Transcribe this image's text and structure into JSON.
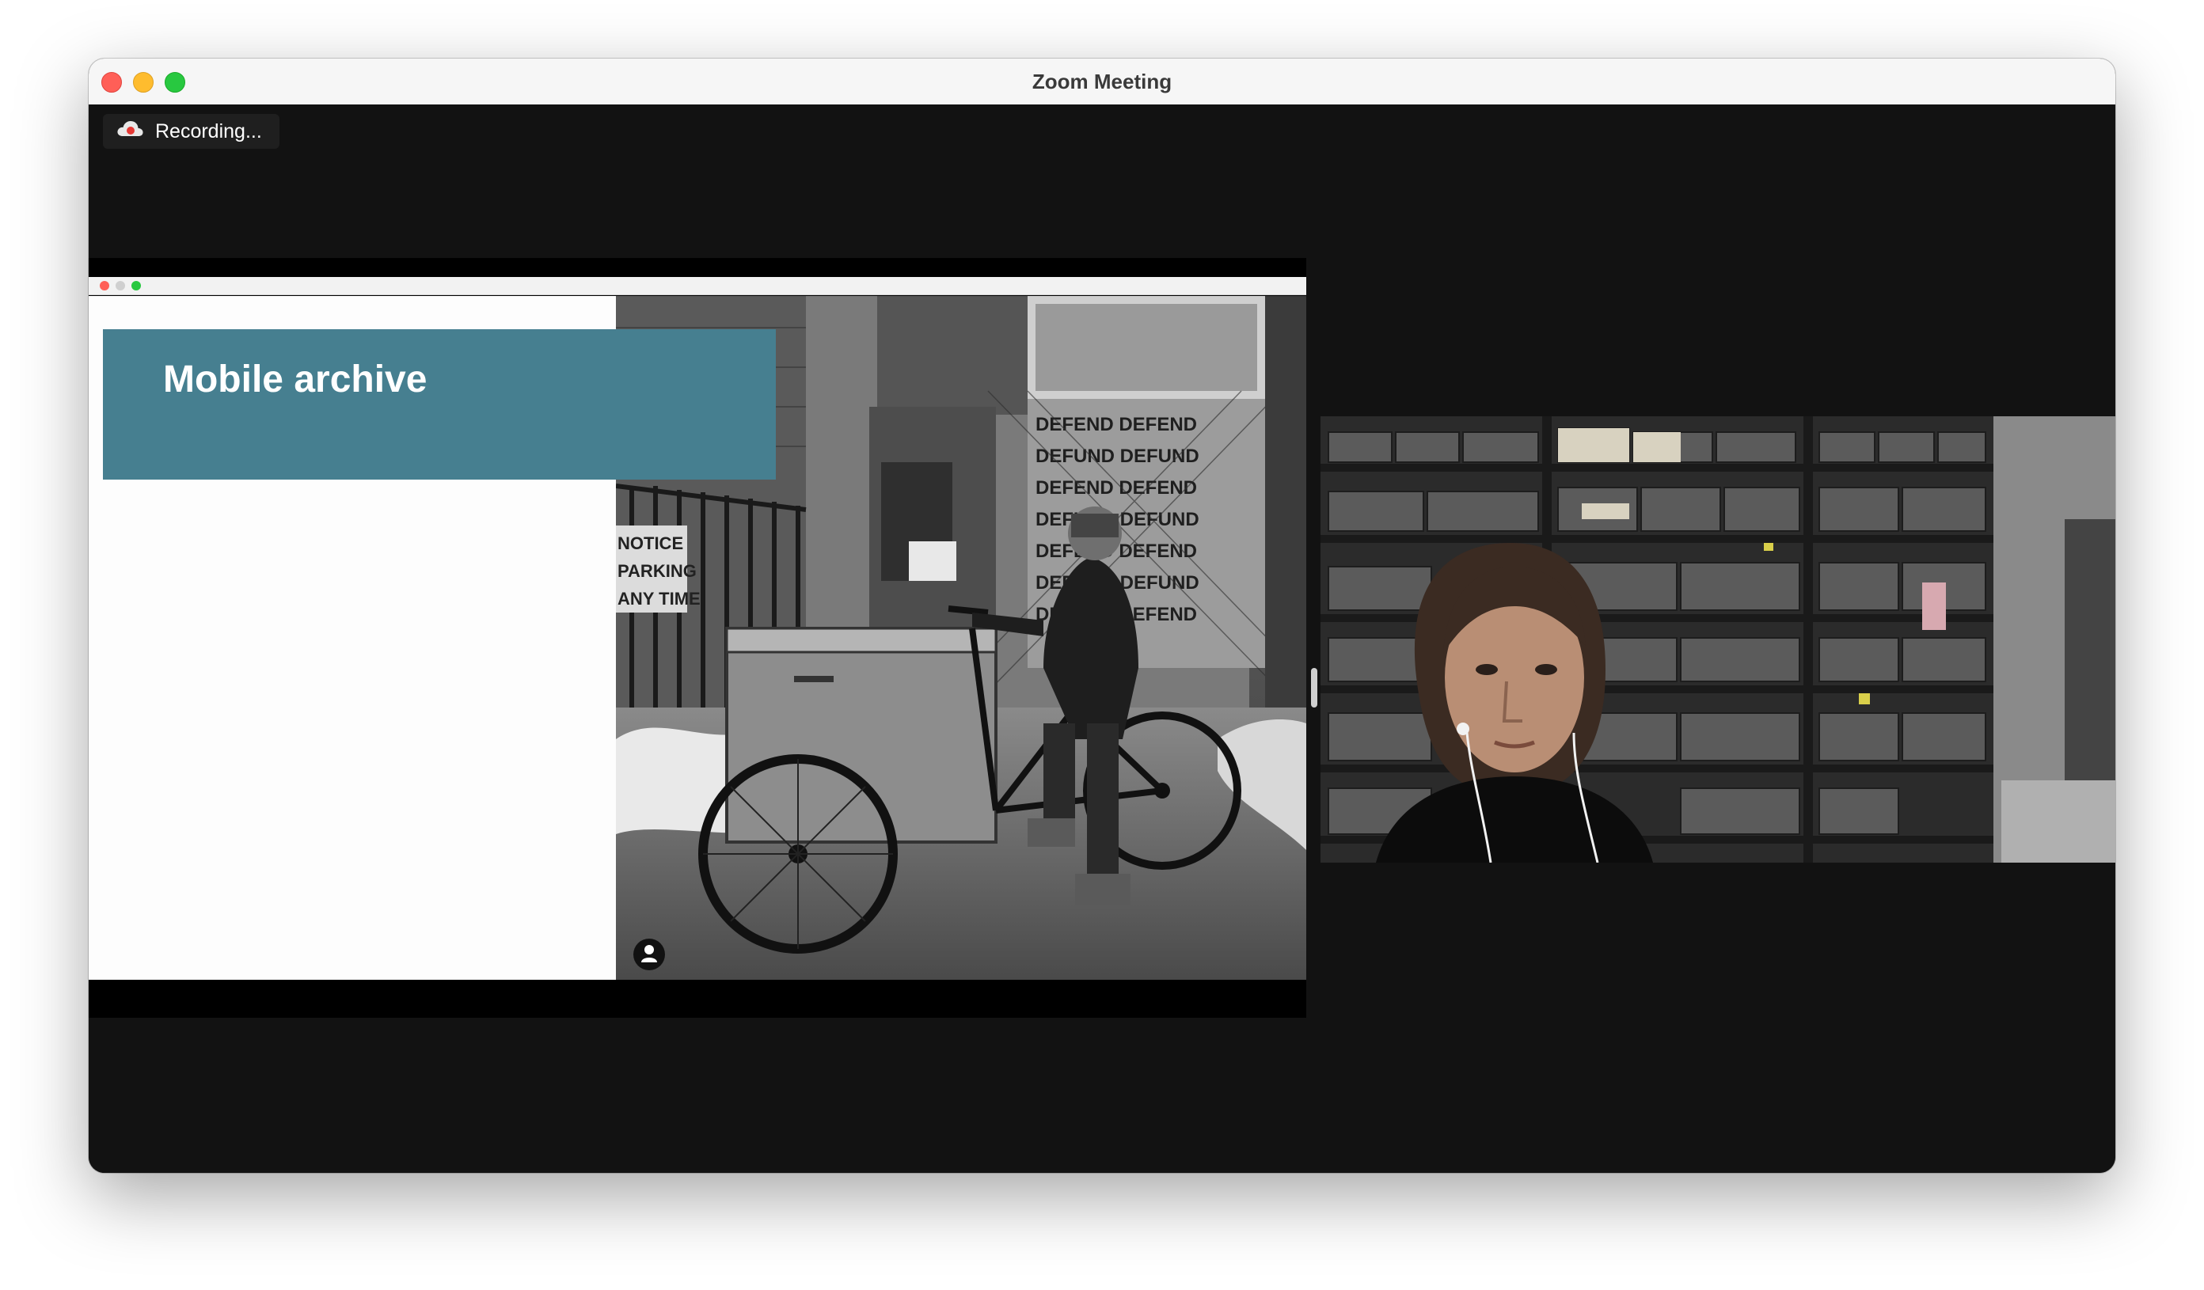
{
  "window": {
    "title": "Zoom Meeting"
  },
  "recording": {
    "label": "Recording...",
    "icon": "cloud-record-icon"
  },
  "shared_screen": {
    "slide_title": "Mobile archive",
    "photo_signs": [
      "DEFEND",
      "DEFUND",
      "NOTICE",
      "PARKING",
      "ANY TIME"
    ]
  },
  "participant_video": {
    "description_icon": "participant-video"
  }
}
